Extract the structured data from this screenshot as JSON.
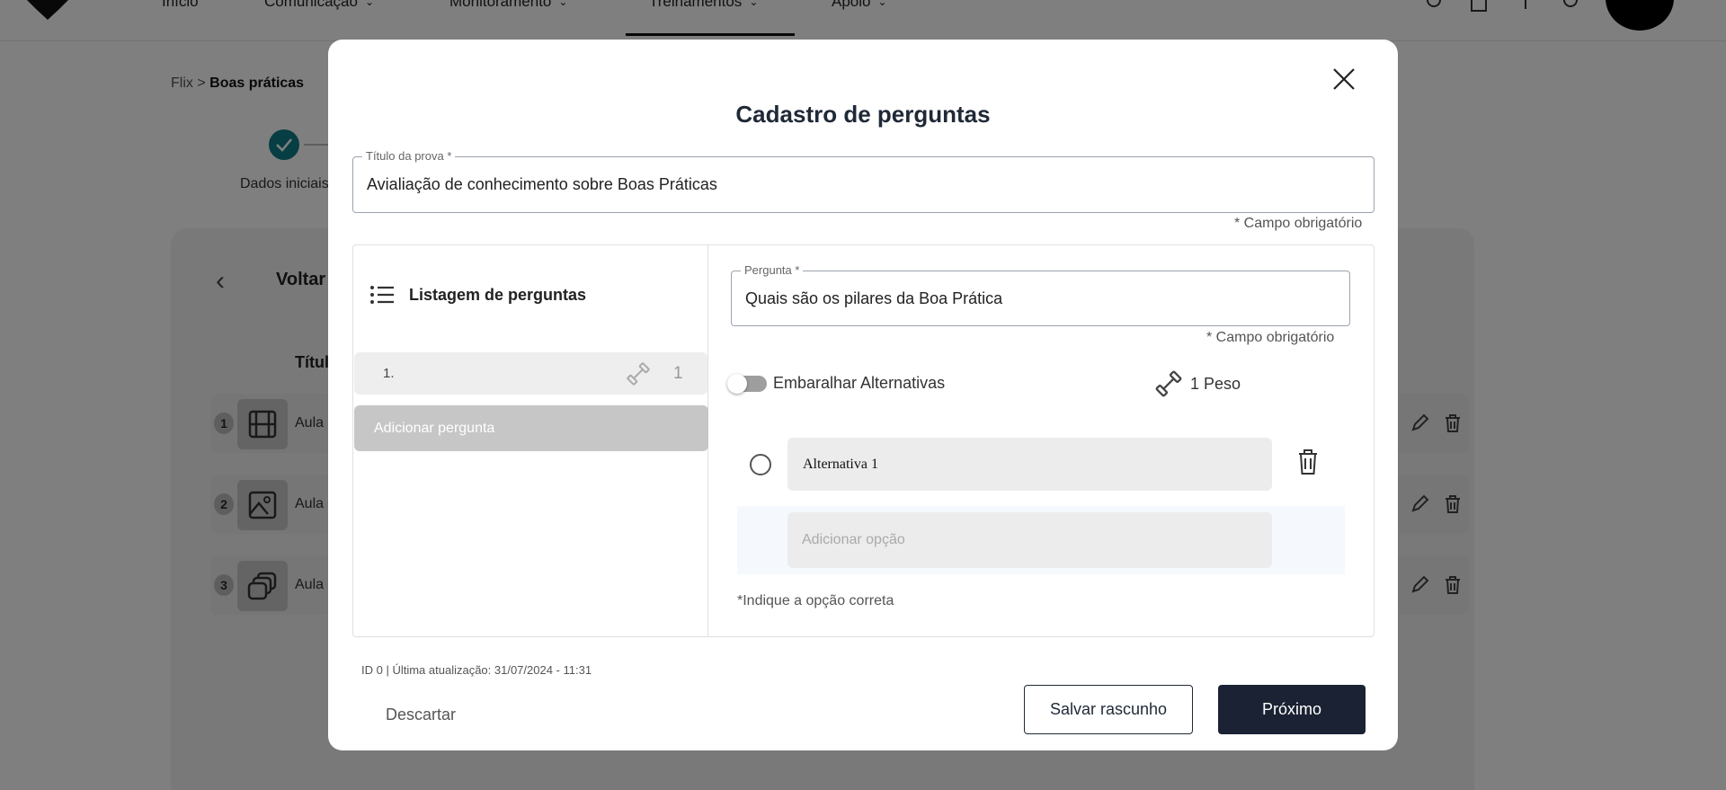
{
  "topnav": {
    "items": [
      {
        "label": "Início"
      },
      {
        "label": "Comunicação"
      },
      {
        "label": "Monitoramento"
      },
      {
        "label": "Treinamentos"
      },
      {
        "label": "Apoio"
      }
    ]
  },
  "breadcrumb": {
    "root": "Flix",
    "separator": ">",
    "current": "Boas práticas"
  },
  "stepper": {
    "step1_label": "Dados iniciais"
  },
  "background": {
    "back_label": "Voltar",
    "column_title": "Títul",
    "lessons": [
      {
        "number": "1",
        "title": "Aula",
        "icon": "film-icon"
      },
      {
        "number": "2",
        "title": "Aula",
        "icon": "image-icon"
      },
      {
        "number": "3",
        "title": "Aula",
        "icon": "gallery-icon"
      }
    ]
  },
  "modal": {
    "title": "Cadastro de perguntas",
    "exam_title": {
      "label": "Título da prova *",
      "value": "Avialiação de conhecimento sobre Boas Práticas",
      "required_note": "* Campo obrigatório"
    },
    "question_list": {
      "header": "Listagem de perguntas",
      "items": [
        {
          "number": "1.",
          "weight": "1"
        }
      ],
      "add_button": "Adicionar pergunta"
    },
    "question": {
      "label": "Pergunta *",
      "value": "Quais são os pilares da Boa Prática",
      "required_note": "* Campo obrigatório"
    },
    "shuffle": {
      "label": "Embaralhar Alternativas",
      "enabled": false
    },
    "weight_label": "1 Peso",
    "alternatives": [
      {
        "text": "Alternativa 1",
        "selected": false
      }
    ],
    "add_option_placeholder": "Adicionar opção",
    "hint": "*Indique a opção correta",
    "meta": "ID 0 | Última atualização: 31/07/2024 - 11:31",
    "buttons": {
      "discard": "Descartar",
      "save_draft": "Salvar rascunho",
      "next": "Próximo"
    }
  },
  "colors": {
    "primary_dark": "#1a2233",
    "teal": "#0f7d86",
    "overlay": "rgba(0,0,0,0.5)"
  }
}
